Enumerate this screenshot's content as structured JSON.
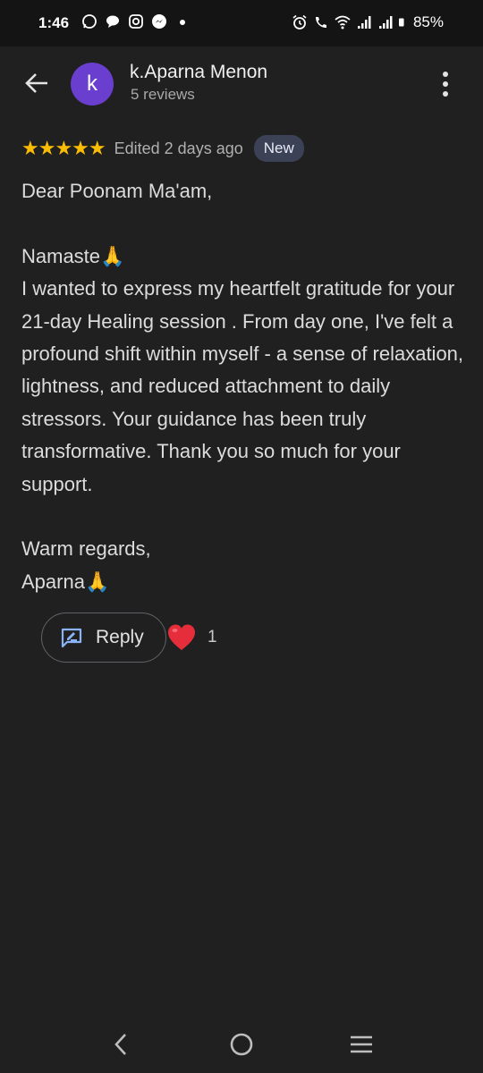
{
  "status_bar": {
    "time": "1:46",
    "battery": "85%",
    "icons_left": [
      "whatsapp-icon",
      "chat-icon",
      "instagram-icon",
      "messenger-icon",
      "dot-icon"
    ],
    "icons_right": [
      "alarm-icon",
      "wifi-calling-icon",
      "wifi-icon",
      "signal-icon",
      "signal-icon",
      "battery-icon"
    ]
  },
  "header": {
    "avatar_letter": "k",
    "name": "k.Aparna Menon",
    "reviews": "5 reviews"
  },
  "review": {
    "stars": "★★★★★",
    "rating": 5,
    "edited": "Edited 2 days ago",
    "badge": "New",
    "text": "Dear Poonam Ma'am,\n\nNamaste🙏\nI wanted to express my heartfelt gratitude for your 21-day Healing session . From day one, I've felt a profound shift within myself - a sense of relaxation, lightness, and reduced attachment to daily stressors. Your guidance has been truly transformative. Thank you so much for your support.\n\nWarm regards,\nAparna🙏"
  },
  "actions": {
    "reply_label": "Reply",
    "reaction_count": "1"
  },
  "colors": {
    "background": "#202020",
    "star": "#fbbc04",
    "avatar": "#6a3fd0",
    "heart": "#e52d3b",
    "reply_icon": "#8ab4f8"
  }
}
